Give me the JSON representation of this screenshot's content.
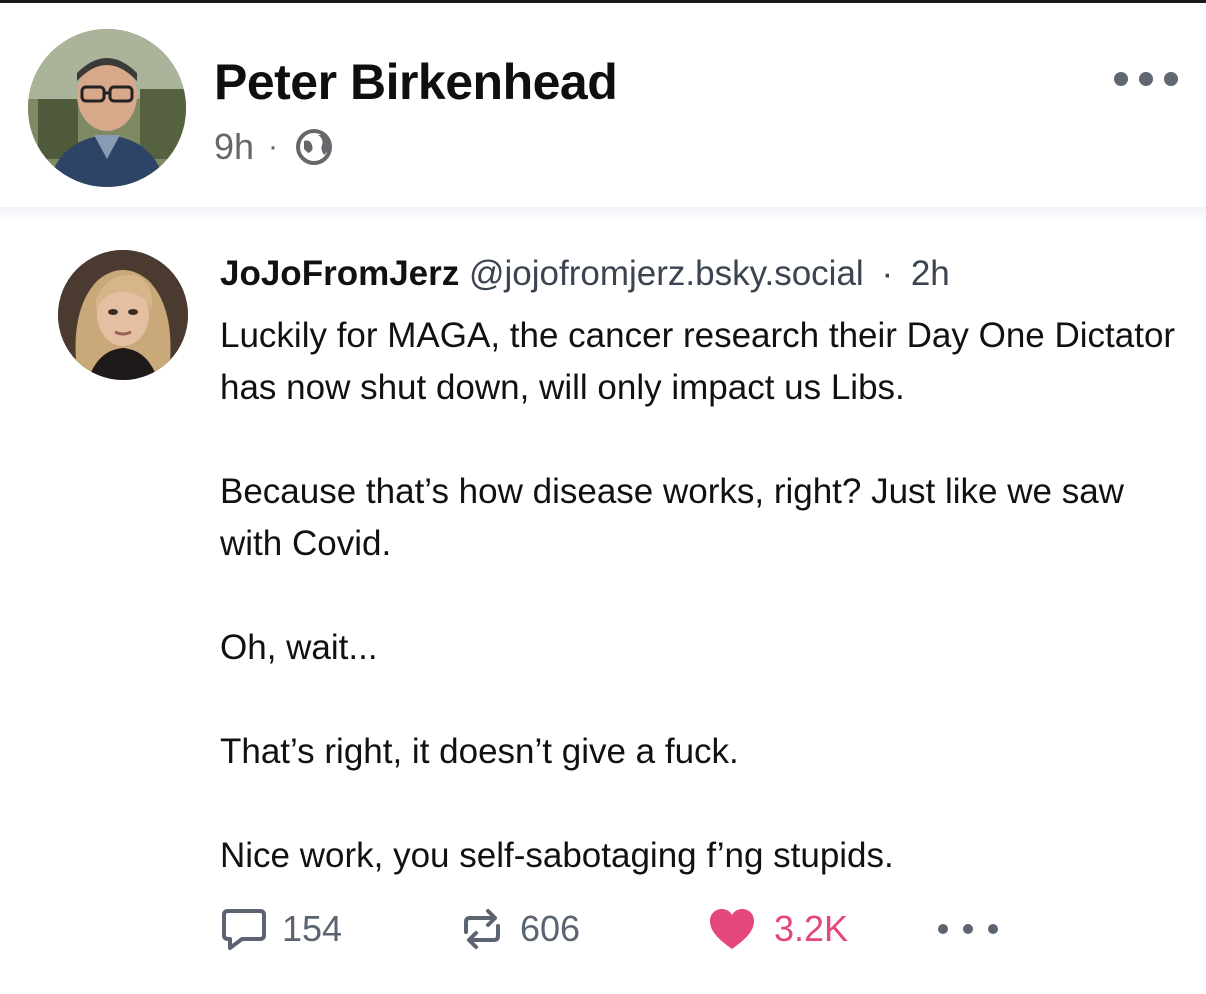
{
  "facebook_post": {
    "author_name": "Peter Birkenhead",
    "timestamp": "9h",
    "separator": "·",
    "audience_icon": "globe-icon",
    "more_icon": "ellipsis-icon"
  },
  "bluesky_post": {
    "display_name": "JoJoFromJerz",
    "handle": "@jojofromjerz.bsky.social",
    "separator": "·",
    "time": "2h",
    "paragraphs": [
      "Luckily for MAGA, the cancer research their Day One Dictator has now shut down, will only impact us Libs.",
      "Because that’s how disease works, right? Just like we saw with Covid.",
      "Oh, wait...",
      "That’s right, it doesn’t give a fuck.",
      "Nice work, you self-sabotaging f’ng stupids."
    ],
    "actions": {
      "reply_count": "154",
      "repost_count": "606",
      "like_count": "3.2K",
      "reply_icon": "speech-bubble-icon",
      "repost_icon": "repost-arrows-icon",
      "like_icon": "heart-icon",
      "more_icon": "ellipsis-icon"
    }
  },
  "colors": {
    "text_primary": "#111111",
    "text_secondary": "#65676b",
    "bsky_secondary": "#5b6470",
    "like_pink": "#e4487a"
  }
}
